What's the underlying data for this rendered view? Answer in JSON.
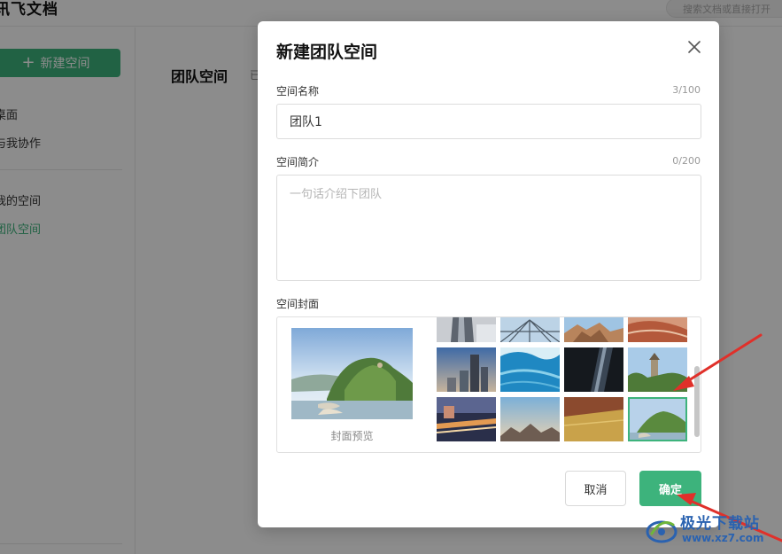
{
  "app": {
    "title": "讯飞文档",
    "search_placeholder": "搜索文档或直接打开"
  },
  "sidebar": {
    "new_space_label": "新建空间",
    "items": [
      {
        "label": "桌面"
      },
      {
        "label": "与我协作"
      },
      {
        "label": "我的空间"
      },
      {
        "label": "团队空间",
        "active": true
      }
    ]
  },
  "main": {
    "title": "团队空间",
    "subtitle": "已"
  },
  "modal": {
    "title": "新建团队空间",
    "name_label": "空间名称",
    "name_counter": "3/100",
    "name_value": "团队1",
    "intro_label": "空间简介",
    "intro_counter": "0/200",
    "intro_placeholder": "一句话介绍下团队",
    "cover_label": "空间封面",
    "preview_label": "封面预览",
    "cancel_label": "取消",
    "confirm_label": "确定",
    "selected_thumb": "landscape-hill-river"
  },
  "watermark": {
    "title": "极光下载站",
    "url": "www.xz7.com"
  },
  "colors": {
    "accent": "#3db37c",
    "annotation_arrow": "#e0302a",
    "watermark": "#2a62b0"
  }
}
